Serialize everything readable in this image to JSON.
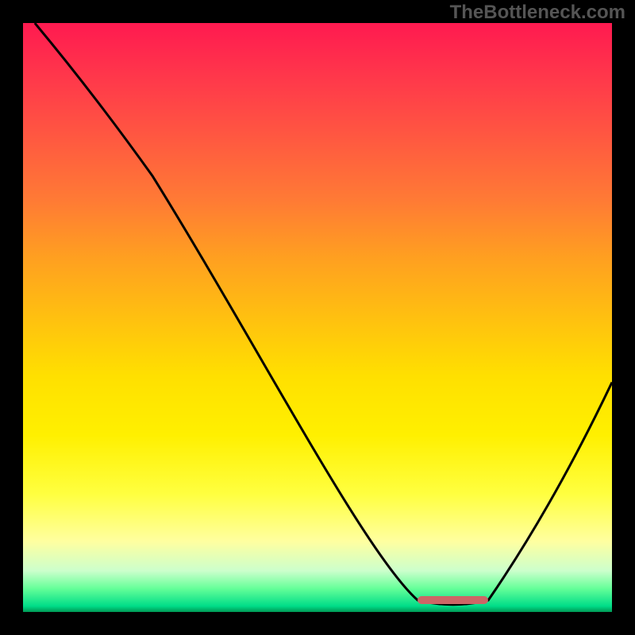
{
  "watermark": "TheBottleneck.com",
  "chart_data": {
    "type": "line",
    "title": "",
    "xlabel": "",
    "ylabel": "",
    "xlim": [
      0,
      100
    ],
    "ylim": [
      0,
      100
    ],
    "series": [
      {
        "name": "bottleneck-curve",
        "points": [
          {
            "x": 2,
            "y": 100
          },
          {
            "x": 22,
            "y": 74
          },
          {
            "x": 67,
            "y": 2
          },
          {
            "x": 79,
            "y": 2
          },
          {
            "x": 100,
            "y": 39
          }
        ],
        "color": "#000000"
      }
    ],
    "optimal_region": {
      "x_start": 67,
      "x_end": 79,
      "y": 2,
      "color": "#cc6666"
    },
    "gradient_meaning": "red=worst, green=best",
    "grid": false
  }
}
